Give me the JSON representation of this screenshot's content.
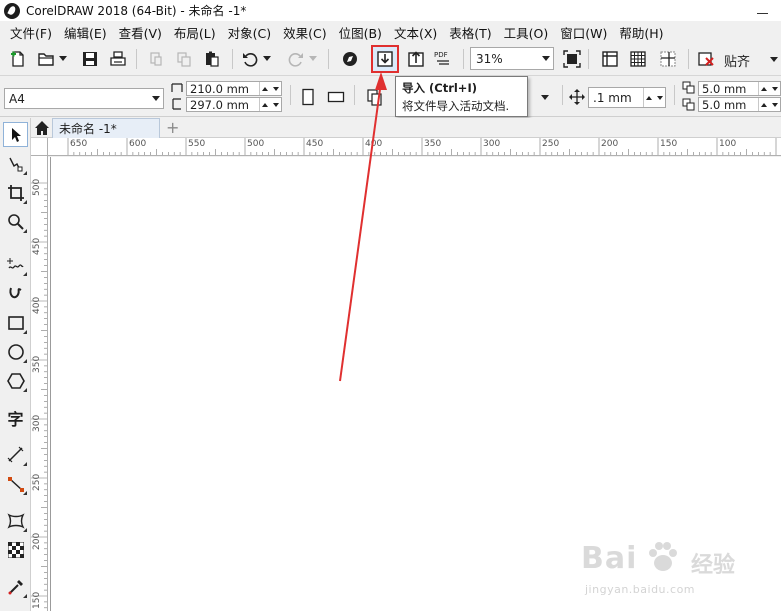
{
  "window": {
    "title": "CorelDRAW 2018 (64-Bit) - 未命名 -1*"
  },
  "menu": [
    "文件(F)",
    "编辑(E)",
    "查看(V)",
    "布局(L)",
    "对象(C)",
    "效果(C)",
    "位图(B)",
    "文本(X)",
    "表格(T)",
    "工具(O)",
    "窗口(W)",
    "帮助(H)"
  ],
  "toolbar": {
    "zoom_value": "31%",
    "pdf_label": "PDF",
    "paste_label": "贴齐"
  },
  "tooltip": {
    "title": "导入 (Ctrl+I)",
    "description": "将文件导入活动文档."
  },
  "property_bar": {
    "page_size": "A4",
    "width": "210.0 mm",
    "height": "297.0 mm",
    "nudge": ".1 mm",
    "dup_x": "5.0 mm",
    "dup_y": "5.0 mm"
  },
  "document_tab": {
    "label": "未命名 -1*",
    "add_symbol": "+"
  },
  "ruler_h": [
    "650",
    "600",
    "550",
    "500",
    "450",
    "400",
    "350",
    "300",
    "250",
    "200",
    "150",
    "100"
  ],
  "ruler_v": [
    "500",
    "450",
    "400",
    "350",
    "300",
    "250",
    "200",
    "150"
  ],
  "ruler_h_unit": "毫米",
  "toolbox": [
    "pick-tool",
    "shape-tool",
    "crop-tool",
    "zoom-tool",
    "freehand-tool",
    "artistic-media-tool",
    "rectangle-tool",
    "ellipse-tool",
    "polygon-tool",
    "text-tool",
    "parallel-dimension-tool",
    "connector-tool",
    "envelope-tool",
    "transparency-tool",
    "eyedropper-tool"
  ],
  "text_tool_glyph": "字",
  "annotation_color": "#e03030",
  "watermark": {
    "brand": "Bai",
    "brand2": "经验",
    "url": "jingyan.baidu.com"
  }
}
